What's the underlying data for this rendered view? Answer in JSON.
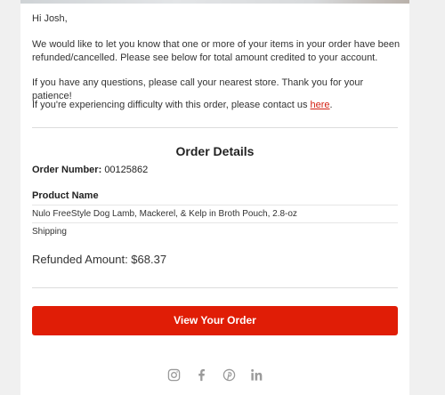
{
  "email": {
    "greeting": "Hi Josh,",
    "paragraph1": "We would like to let you know that one or more of your items in your order have been refunded/cancelled. Please see below for total amount credited to your account.",
    "paragraph2": "If you have any questions, please call your nearest store. Thank you for your patience!",
    "paragraph3_prefix": "If you're experiencing difficulty with this order, please contact us ",
    "paragraph3_link": "here",
    "paragraph3_suffix": "."
  },
  "order": {
    "heading": "Order Details",
    "number_label": "Order Number:",
    "number_value": "00125862",
    "product_header": "Product Name",
    "product_name": "Nulo FreeStyle Dog Lamb, Mackerel, & Kelp in Broth Pouch, 2.8-oz",
    "shipping_label": "Shipping",
    "refunded_amount": "Refunded Amount: $68.37"
  },
  "cta": {
    "label": "View Your Order"
  },
  "socials": [
    "instagram-icon",
    "facebook-icon",
    "pinterest-icon",
    "linkedin-icon"
  ],
  "colors": {
    "accent": "#e01d06",
    "link": "#d31f11",
    "icon": "#9a9a9a"
  }
}
